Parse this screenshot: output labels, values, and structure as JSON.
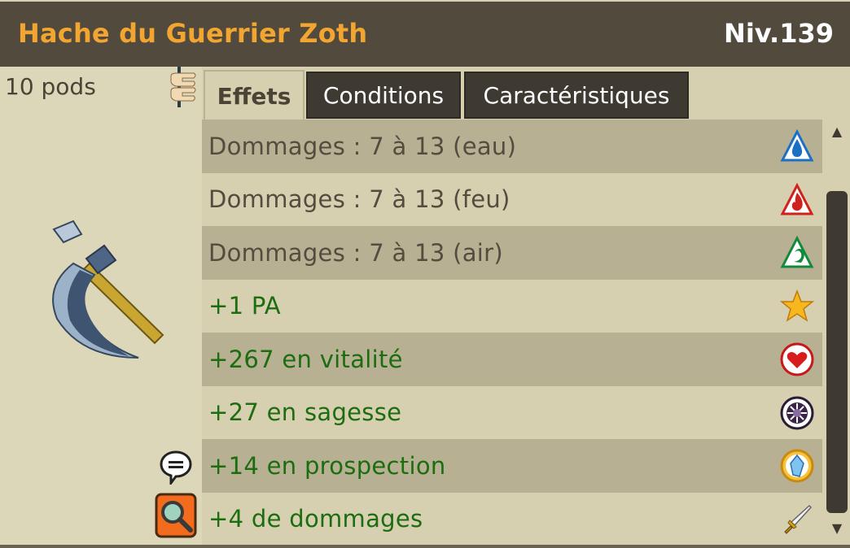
{
  "header": {
    "item_name": "Hache du Guerrier Zoth",
    "level": "Niv.139"
  },
  "sidebar": {
    "weight": "10 pods"
  },
  "tabs": [
    {
      "label": "Effets",
      "active": true
    },
    {
      "label": "Conditions",
      "active": false
    },
    {
      "label": "Caractéristiques",
      "active": false
    }
  ],
  "effects": [
    {
      "text": "Dommages : 7 à 13 (eau)",
      "color": "gray",
      "icon": "water-element-icon"
    },
    {
      "text": "Dommages : 7 à 13 (feu)",
      "color": "gray",
      "icon": "fire-element-icon"
    },
    {
      "text": "Dommages : 7 à 13 (air)",
      "color": "gray",
      "icon": "air-element-icon"
    },
    {
      "text": "+1 PA",
      "color": "green",
      "icon": "star-icon"
    },
    {
      "text": "+267 en vitalité",
      "color": "green",
      "icon": "heart-icon"
    },
    {
      "text": "+27 en sagesse",
      "color": "green",
      "icon": "wisdom-icon"
    },
    {
      "text": "+14 en prospection",
      "color": "green",
      "icon": "prospecting-icon"
    },
    {
      "text": "+4 de dommages",
      "color": "green",
      "icon": "sword-icon"
    }
  ],
  "colors": {
    "title": "#f2a531",
    "header_bg": "#514a3d",
    "positive_effect": "#1c6d10",
    "damage_effect": "#534c3f"
  }
}
